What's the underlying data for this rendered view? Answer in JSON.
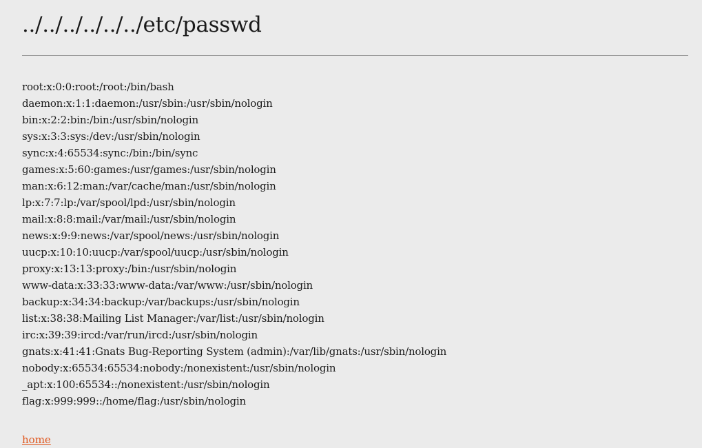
{
  "page": {
    "title": "../../../../../../etc/passwd"
  },
  "file": {
    "lines": [
      "root:x:0:0:root:/root:/bin/bash",
      "daemon:x:1:1:daemon:/usr/sbin:/usr/sbin/nologin",
      "bin:x:2:2:bin:/bin:/usr/sbin/nologin",
      "sys:x:3:3:sys:/dev:/usr/sbin/nologin",
      "sync:x:4:65534:sync:/bin:/bin/sync",
      "games:x:5:60:games:/usr/games:/usr/sbin/nologin",
      "man:x:6:12:man:/var/cache/man:/usr/sbin/nologin",
      "lp:x:7:7:lp:/var/spool/lpd:/usr/sbin/nologin",
      "mail:x:8:8:mail:/var/mail:/usr/sbin/nologin",
      "news:x:9:9:news:/var/spool/news:/usr/sbin/nologin",
      "uucp:x:10:10:uucp:/var/spool/uucp:/usr/sbin/nologin",
      "proxy:x:13:13:proxy:/bin:/usr/sbin/nologin",
      "www-data:x:33:33:www-data:/var/www:/usr/sbin/nologin",
      "backup:x:34:34:backup:/var/backups:/usr/sbin/nologin",
      "list:x:38:38:Mailing List Manager:/var/list:/usr/sbin/nologin",
      "irc:x:39:39:ircd:/var/run/ircd:/usr/sbin/nologin",
      "gnats:x:41:41:Gnats Bug-Reporting System (admin):/var/lib/gnats:/usr/sbin/nologin",
      "nobody:x:65534:65534:nobody:/nonexistent:/usr/sbin/nologin",
      "_apt:x:100:65534::/nonexistent:/usr/sbin/nologin",
      "flag:x:999:999::/home/flag:/usr/sbin/nologin"
    ]
  },
  "footer": {
    "home_link": "home"
  },
  "colors": {
    "background": "#ebebeb",
    "text": "#1a1a1a",
    "link": "#e0541a",
    "divider": "#9a9a9a"
  }
}
